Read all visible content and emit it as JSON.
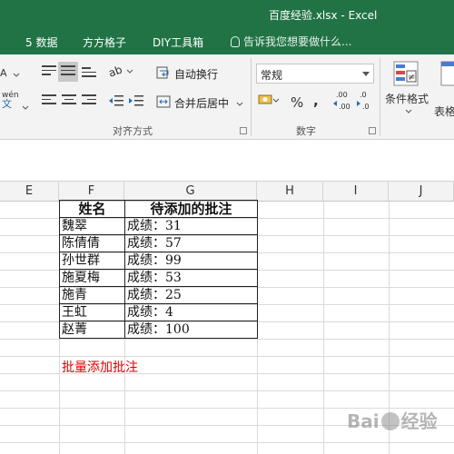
{
  "window": {
    "title": "百度经验.xlsx - Excel"
  },
  "menu": {
    "tabs": [
      "5 数据",
      "方方格子",
      "DIY工具箱"
    ],
    "tell_me": "告诉我您想要做什么..."
  },
  "ribbon": {
    "wen_label": "wén",
    "wen_sub": "文",
    "wrap_text": "自动换行",
    "merge_center": "合并后居中",
    "alignment_group": "对齐方式",
    "number_format": "常规",
    "percent": "%",
    "comma": ",",
    "dec_increase": ".00",
    "dec_decrease": ".0",
    "number_group": "数字",
    "cond_format": "条件格式",
    "table_format": "表格"
  },
  "grid": {
    "columns": [
      "E",
      "F",
      "G",
      "H",
      "I",
      "J"
    ],
    "table": {
      "headers": [
        "姓名",
        "待添加的批注"
      ],
      "rows": [
        [
          "魏翠",
          "成绩：31"
        ],
        [
          "陈倩倩",
          "成绩：57"
        ],
        [
          "孙世群",
          "成绩：99"
        ],
        [
          "施夏梅",
          "成绩：53"
        ],
        [
          "施青",
          "成绩：25"
        ],
        [
          "王虹",
          "成绩：4"
        ],
        [
          "赵菁",
          "成绩：100"
        ]
      ]
    },
    "note": "批量添加批注"
  },
  "watermark": {
    "text": "Bai度经验"
  }
}
